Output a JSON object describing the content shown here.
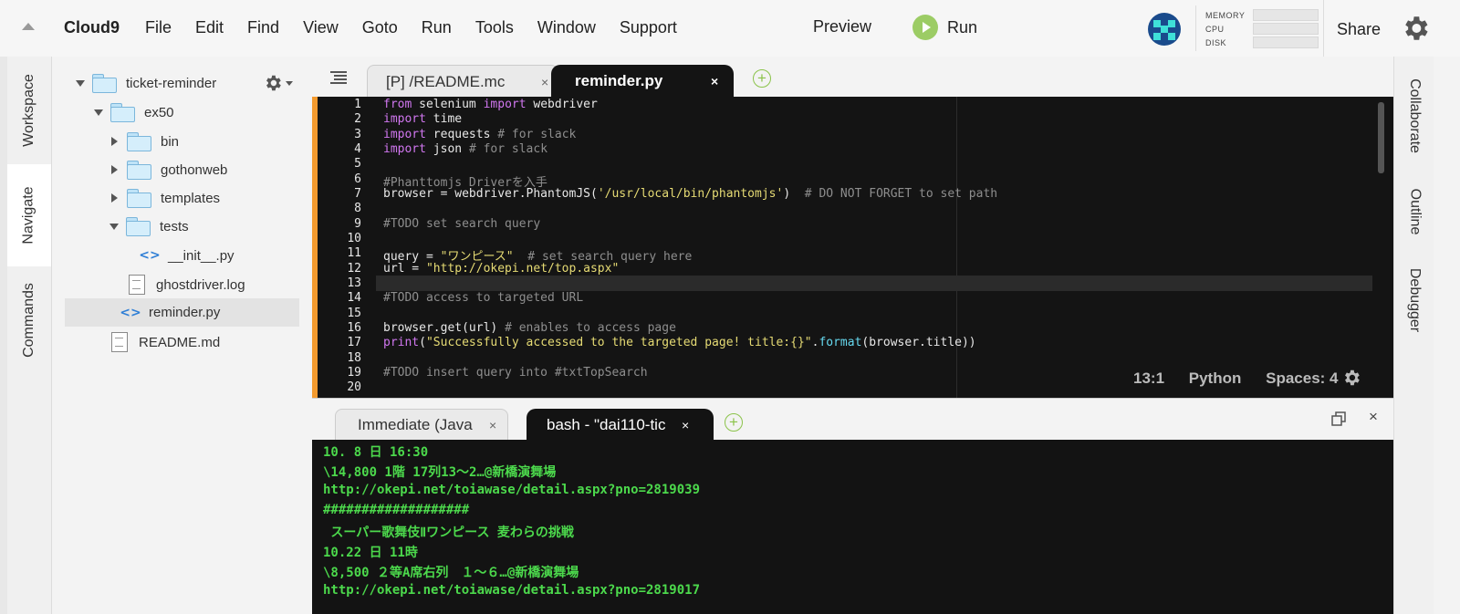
{
  "menubar": {
    "logo": "Cloud9",
    "menus": [
      "File",
      "Edit",
      "Find",
      "View",
      "Goto",
      "Run",
      "Tools",
      "Window",
      "Support"
    ],
    "preview": "Preview",
    "run": "Run",
    "stats": [
      "MEMORY",
      "CPU",
      "DISK"
    ],
    "share": "Share"
  },
  "left_tabs": [
    "Workspace",
    "Navigate",
    "Commands"
  ],
  "right_tabs": [
    "Collaborate",
    "Outline",
    "Debugger"
  ],
  "tree": [
    {
      "label": "ticket-reminder",
      "type": "folder-open"
    },
    {
      "label": "ex50",
      "type": "folder-open"
    },
    {
      "label": "bin",
      "type": "folder-closed"
    },
    {
      "label": "gothonweb",
      "type": "folder-closed"
    },
    {
      "label": "templates",
      "type": "folder-closed"
    },
    {
      "label": "tests",
      "type": "folder-open"
    },
    {
      "label": "__init__.py",
      "type": "py"
    },
    {
      "label": "ghostdriver.log",
      "type": "file"
    },
    {
      "label": "reminder.py",
      "type": "py"
    },
    {
      "label": "README.md",
      "type": "file"
    }
  ],
  "editor": {
    "tabs": [
      "[P] /README.mc",
      "reminder.py"
    ],
    "close_glyph": "×",
    "status": {
      "position": "13:1",
      "language": "Python",
      "spaces": "Spaces: 4"
    },
    "lines": [
      {
        "n": "1",
        "t": "from selenium import webdriver"
      },
      {
        "n": "2",
        "t": "import time"
      },
      {
        "n": "3",
        "t": "import requests # for slack"
      },
      {
        "n": "4",
        "t": "import json # for slack"
      },
      {
        "n": "5",
        "t": ""
      },
      {
        "n": "6",
        "t": "#Phanttomjs Driverを入手"
      },
      {
        "n": "7",
        "t": "browser = webdriver.PhantomJS('/usr/local/bin/phantomjs')  # DO NOT FORGET to set path"
      },
      {
        "n": "8",
        "t": ""
      },
      {
        "n": "9",
        "t": "#TODO set search query"
      },
      {
        "n": "10",
        "t": ""
      },
      {
        "n": "11",
        "t": "query = \"ワンピース\"  # set search query here"
      },
      {
        "n": "12",
        "t": "url = \"http://okepi.net/top.aspx\""
      },
      {
        "n": "13",
        "t": ""
      },
      {
        "n": "14",
        "t": "#TODO access to targeted URL"
      },
      {
        "n": "15",
        "t": ""
      },
      {
        "n": "16",
        "t": "browser.get(url) # enables to access page"
      },
      {
        "n": "17",
        "t": "print(\"Successfully accessed to the targeted page! title:{}\".format(browser.title))"
      },
      {
        "n": "18",
        "t": ""
      },
      {
        "n": "19",
        "t": "#TODO insert query into #txtTopSearch"
      },
      {
        "n": "20",
        "t": ""
      }
    ]
  },
  "terminal": {
    "tabs": [
      "Immediate (Java",
      "bash - \"dai110-tic"
    ],
    "lines": [
      "10. 8 日 16:30",
      "\\14,800 1階 17列13～2…@新橋演舞場",
      "http://okepi.net/toiawase/detail.aspx?pno=2819039",
      "###################",
      " スーパー歌舞伎Ⅱワンピース 麦わらの挑戦",
      "10.22 日 11時",
      "\\8,500 ２等A席右列　１～６…@新橋演舞場",
      "http://okepi.net/toiawase/detail.aspx?pno=2819017"
    ]
  },
  "colors": {
    "accent_run": "#9ccc65",
    "terminal_text": "#4cd94c",
    "gutter_marker": "#f39a2e"
  }
}
